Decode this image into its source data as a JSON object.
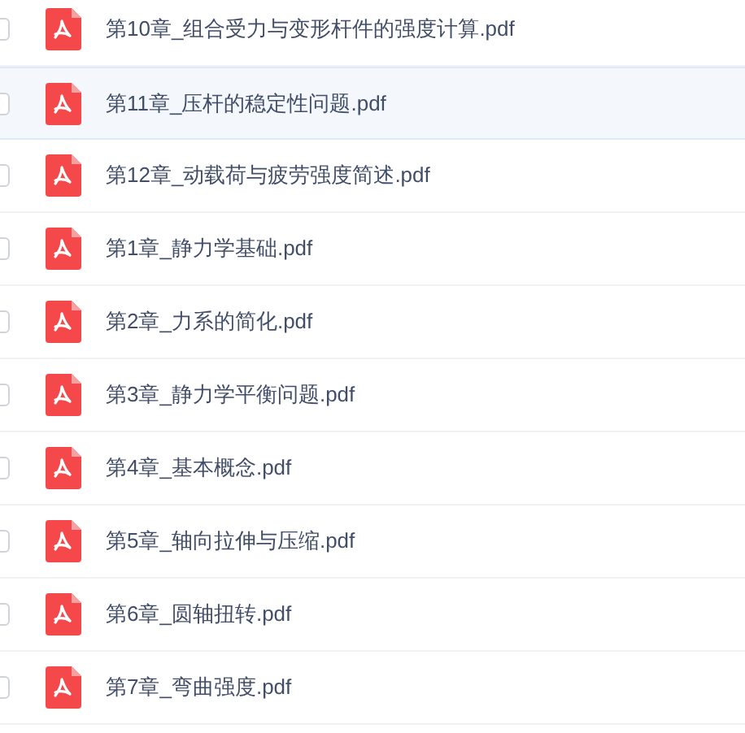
{
  "files": [
    {
      "name": "第10章_组合受力与变形杆件的强度计算.pdf",
      "selected": false,
      "checked": false
    },
    {
      "name": "第11章_压杆的稳定性问题.pdf",
      "selected": true,
      "checked": false
    },
    {
      "name": "第12章_动载荷与疲劳强度简述.pdf",
      "selected": false,
      "checked": false
    },
    {
      "name": "第1章_静力学基础.pdf",
      "selected": false,
      "checked": false
    },
    {
      "name": "第2章_力系的简化.pdf",
      "selected": false,
      "checked": false
    },
    {
      "name": "第3章_静力学平衡问题.pdf",
      "selected": false,
      "checked": false
    },
    {
      "name": "第4章_基本概念.pdf",
      "selected": false,
      "checked": false
    },
    {
      "name": "第5章_轴向拉伸与压缩.pdf",
      "selected": false,
      "checked": false
    },
    {
      "name": "第6章_圆轴扭转.pdf",
      "selected": false,
      "checked": false
    },
    {
      "name": "第7章_弯曲强度.pdf",
      "selected": false,
      "checked": false
    }
  ]
}
